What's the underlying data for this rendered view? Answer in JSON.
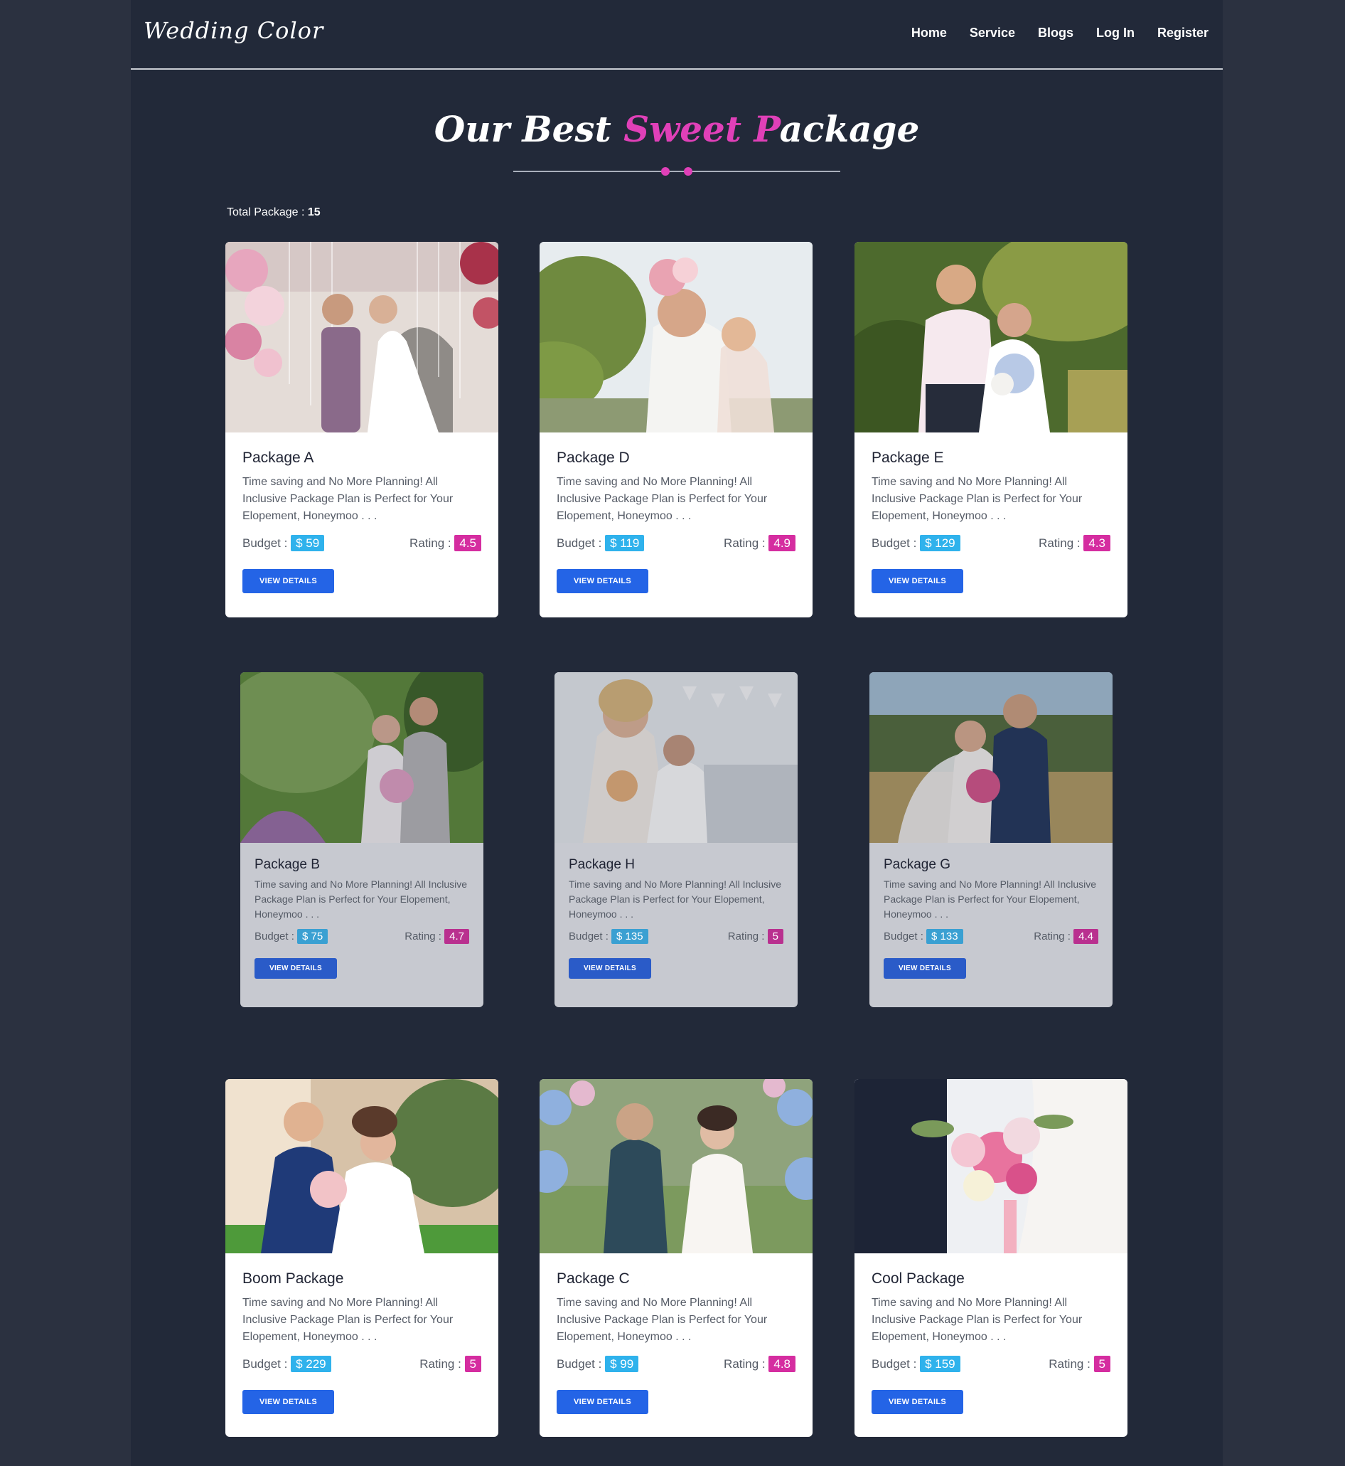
{
  "brand": "Wedding Color",
  "nav": [
    "Home",
    "Service",
    "Blogs",
    "Log In",
    "Register"
  ],
  "section": {
    "title_part1": "Our Best ",
    "title_accent": "Sweet P",
    "title_part2": "ackage",
    "total_label": "Total Package : ",
    "total_value": "15"
  },
  "colors": {
    "page_bg": "#222939",
    "accent_pink": "#e040b8",
    "button_blue": "#2464e6",
    "budget_badge": "#2fb2ec",
    "rating_badge": "#d52da0"
  },
  "labels": {
    "budget": "Budget : ",
    "rating": "Rating : ",
    "button": "VIEW DETAILS"
  },
  "packages": [
    {
      "name": "Package A",
      "description": "Time saving and No More Planning! All Inclusive Package Plan is Perfect for Your Elopement, Honeymoo . . .",
      "budget": "$ 59",
      "rating": "4.5"
    },
    {
      "name": "Package D",
      "description": "Time saving and No More Planning! All Inclusive Package Plan is Perfect for Your Elopement, Honeymoo . . .",
      "budget": "$ 119",
      "rating": "4.9"
    },
    {
      "name": "Package E",
      "description": "Time saving and No More Planning! All Inclusive Package Plan is Perfect for Your Elopement, Honeymoo . . .",
      "budget": "$ 129",
      "rating": "4.3"
    },
    {
      "name": "Package B",
      "description": "Time saving and No More Planning! All Inclusive Package Plan is Perfect for Your Elopement, Honeymoo . . .",
      "budget": "$ 75",
      "rating": "4.7"
    },
    {
      "name": "Package H",
      "description": "Time saving and No More Planning! All Inclusive Package Plan is Perfect for Your Elopement, Honeymoo . . .",
      "budget": "$ 135",
      "rating": "5"
    },
    {
      "name": "Package G",
      "description": "Time saving and No More Planning! All Inclusive Package Plan is Perfect for Your Elopement, Honeymoo . . .",
      "budget": "$ 133",
      "rating": "4.4"
    },
    {
      "name": "Boom Package",
      "description": "Time saving and No More Planning! All Inclusive Package Plan is Perfect for Your Elopement, Honeymoo . . .",
      "budget": "$ 229",
      "rating": "5"
    },
    {
      "name": "Package C",
      "description": "Time saving and No More Planning! All Inclusive Package Plan is Perfect for Your Elopement, Honeymoo . . .",
      "budget": "$ 99",
      "rating": "4.8"
    },
    {
      "name": "Cool Package",
      "description": "Time saving and No More Planning! All Inclusive Package Plan is Perfect for Your Elopement, Honeymoo . . .",
      "budget": "$ 159",
      "rating": "5"
    }
  ]
}
